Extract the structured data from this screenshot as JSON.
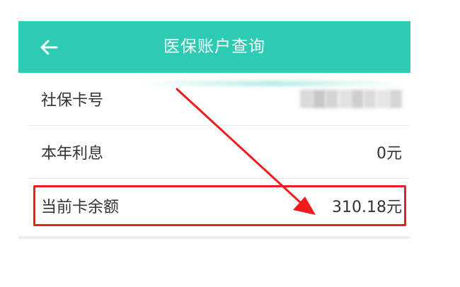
{
  "header": {
    "title": "医保账户查询",
    "back_icon": "arrow-left-icon",
    "background": "#2dcbb3"
  },
  "rows": [
    {
      "label": "社保卡号",
      "value": ""
    },
    {
      "label": "本年利息",
      "value": "0元"
    },
    {
      "label": "当前卡余额",
      "value": "310.18元"
    }
  ],
  "annotation": {
    "highlight_color": "#ee1c1c",
    "arrow_icon": "red-arrow-annotation"
  }
}
